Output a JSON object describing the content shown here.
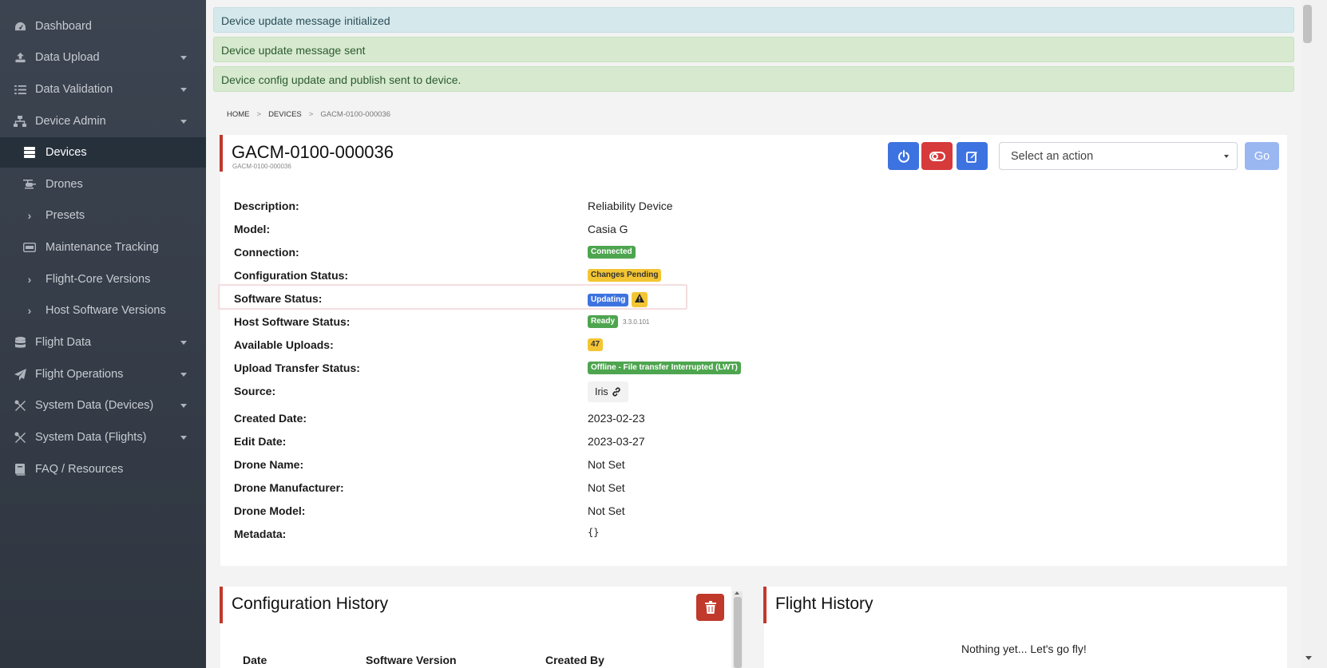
{
  "sidebar": {
    "items": [
      {
        "label": "Dashboard",
        "icon": "dashboard-icon"
      },
      {
        "label": "Data Upload",
        "icon": "upload-icon"
      },
      {
        "label": "Data Validation",
        "icon": "list-check-icon"
      },
      {
        "label": "Device Admin",
        "icon": "sitemap-icon"
      },
      {
        "label": "Devices",
        "icon": "server-icon"
      },
      {
        "label": "Drones",
        "icon": "helicopter-icon"
      },
      {
        "label": "Presets",
        "icon": "chevron-right-icon"
      },
      {
        "label": "Maintenance Tracking",
        "icon": "hdd-icon"
      },
      {
        "label": "Flight-Core Versions",
        "icon": "chevron-right-icon"
      },
      {
        "label": "Host Software Versions",
        "icon": "chevron-right-icon"
      },
      {
        "label": "Flight Data",
        "icon": "database-icon"
      },
      {
        "label": "Flight Operations",
        "icon": "paper-plane-icon"
      },
      {
        "label": "System Data (Devices)",
        "icon": "tools-icon"
      },
      {
        "label": "System Data (Flights)",
        "icon": "tools-icon"
      },
      {
        "label": "FAQ / Resources",
        "icon": "book-icon"
      }
    ]
  },
  "alerts": {
    "info": "Device update message initialized",
    "sent": "Device update message sent",
    "config": "Device config update and publish sent to device."
  },
  "breadcrumb": {
    "home": "HOME",
    "sep": ">",
    "devices": "DEVICES",
    "current": "GACM-0100-000036"
  },
  "device": {
    "title": "GACM-0100-000036",
    "subtitle": "GACM-0100-000036",
    "action_select_placeholder": "Select an action",
    "go_label": "Go"
  },
  "details": {
    "description": {
      "label": "Description:",
      "value": "Reliability Device"
    },
    "model": {
      "label": "Model:",
      "value": "Casia G"
    },
    "connection": {
      "label": "Connection:",
      "value": "Connected"
    },
    "config_status": {
      "label": "Configuration Status:",
      "value": "Changes Pending"
    },
    "software_status": {
      "label": "Software Status:",
      "value": "Updating"
    },
    "host_software_status": {
      "label": "Host Software Status:",
      "value": "Ready",
      "version": "3.3.0.101"
    },
    "available_uploads": {
      "label": "Available Uploads:",
      "value": "47"
    },
    "upload_transfer_status": {
      "label": "Upload Transfer Status:",
      "value": "Offline - File transfer Interrupted (LWT)"
    },
    "source": {
      "label": "Source:",
      "value": "Iris"
    },
    "created_date": {
      "label": "Created Date:",
      "value": "2023-02-23"
    },
    "edit_date": {
      "label": "Edit Date:",
      "value": "2023-03-27"
    },
    "drone_name": {
      "label": "Drone Name:",
      "value": "Not Set"
    },
    "drone_manufacturer": {
      "label": "Drone Manufacturer:",
      "value": "Not Set"
    },
    "drone_model": {
      "label": "Drone Model:",
      "value": "Not Set"
    },
    "metadata": {
      "label": "Metadata:",
      "value": "{}"
    }
  },
  "config_history": {
    "title": "Configuration History",
    "columns": [
      "Date",
      "Software Version",
      "Created By"
    ]
  },
  "flight_history": {
    "title": "Flight History",
    "empty": "Nothing yet... Let's go fly!"
  },
  "colors": {
    "sidebar_bg": "#3c4451",
    "accent_red": "#c0392b",
    "primary_blue": "#3d73e0",
    "success_green": "#4ea54f",
    "warning_yellow": "#f3c534"
  }
}
